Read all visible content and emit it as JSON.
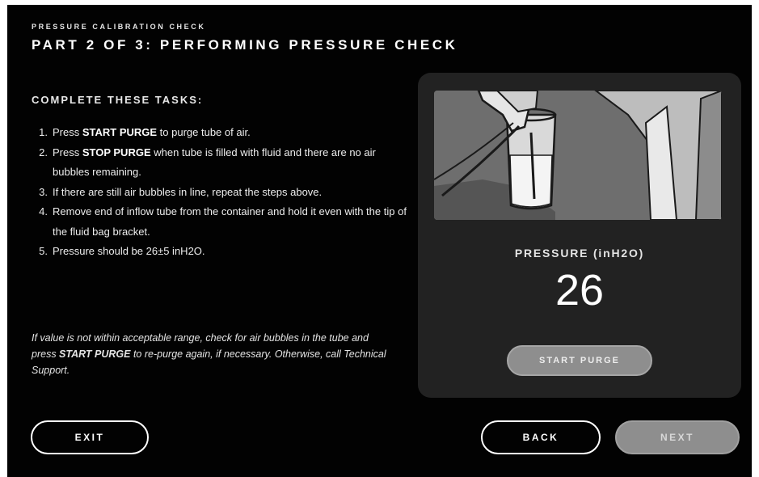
{
  "header": {
    "kicker": "PRESSURE CALIBRATION CHECK",
    "title": "PART 2 OF 3: PERFORMING PRESSURE CHECK"
  },
  "instructions": {
    "heading": "COMPLETE THESE TASKS:",
    "steps": [
      {
        "num": "1.",
        "pre": "Press ",
        "bold": "START PURGE",
        "post": " to purge tube of air."
      },
      {
        "num": "2.",
        "pre": "Press ",
        "bold": "STOP PURGE",
        "post": " when tube is filled with fluid and there are no air bubbles remaining."
      },
      {
        "num": "3.",
        "pre": "",
        "bold": "",
        "post": "If there are still air bubbles in line, repeat the steps above."
      },
      {
        "num": "4.",
        "pre": "",
        "bold": "",
        "post": "Remove end of inflow tube from the container and hold it even with the tip of the fluid bag bracket."
      },
      {
        "num": "5.",
        "pre": "",
        "bold": "",
        "post": "Pressure should be 26±5 inH2O."
      }
    ],
    "note": {
      "pre": "If value is not within acceptable range, check for air bubbles in the tube and press ",
      "bold": "START PURGE",
      "post": " to re-purge again, if necessary. Otherwise, call Technical Support."
    }
  },
  "panel": {
    "illustration": "hand-holding-tube-in-beaker-illustration",
    "pressure_label": "PRESSURE (inH2O)",
    "pressure_value": "26",
    "purge_button": "START PURGE"
  },
  "footer": {
    "exit": "EXIT",
    "back": "BACK",
    "next": "NEXT"
  },
  "colors": {
    "background": "#020202",
    "panel": "#222222",
    "disabled_button": "#8e8e8e",
    "text": "#f2f2f2"
  }
}
